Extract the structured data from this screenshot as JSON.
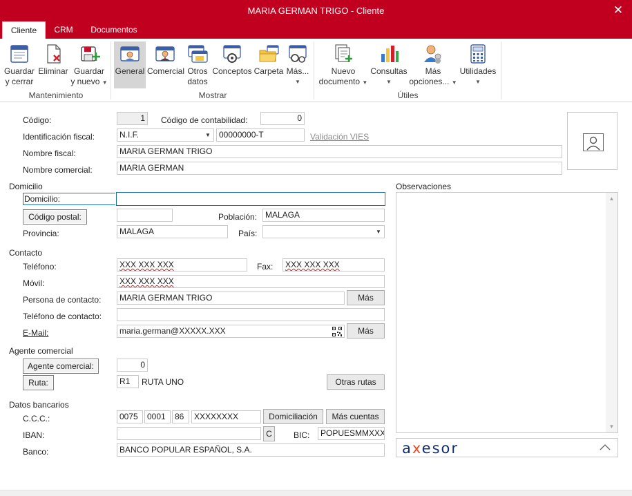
{
  "window": {
    "title": "MARIA GERMAN TRIGO - Cliente"
  },
  "tabs": [
    {
      "label": "Cliente",
      "active": true
    },
    {
      "label": "CRM"
    },
    {
      "label": "Documentos"
    }
  ],
  "ribbon": {
    "groups": {
      "mantenimiento": "Mantenimiento",
      "mostrar": "Mostrar",
      "utiles": "Útiles"
    },
    "buttons": {
      "guardar_cerrar": [
        "Guardar",
        "y cerrar"
      ],
      "eliminar": "Eliminar",
      "guardar_nuevo": [
        "Guardar",
        "y nuevo"
      ],
      "general": "General",
      "comercial": "Comercial",
      "otros_datos": [
        "Otros",
        "datos"
      ],
      "conceptos": "Conceptos",
      "carpeta": "Carpeta",
      "mas": "Más...",
      "nuevo_documento": [
        "Nuevo",
        "documento"
      ],
      "consultas": "Consultas",
      "mas_opciones": [
        "Más",
        "opciones..."
      ],
      "utilidades": "Utilidades"
    }
  },
  "form": {
    "codigo": {
      "label": "Código:",
      "value": "1"
    },
    "codigo_contabilidad": {
      "label": "Código de contabilidad:",
      "value": "0"
    },
    "identificacion_fiscal": {
      "label": "Identificación fiscal:",
      "type": "N.I.F.",
      "value": "00000000-T",
      "link": "Validación VIES"
    },
    "nombre_fiscal": {
      "label": "Nombre fiscal:",
      "value": "MARIA GERMAN TRIGO"
    },
    "nombre_comercial": {
      "label": "Nombre comercial:",
      "value": "MARIA GERMAN"
    },
    "domicilio_section": "Domicilio",
    "domicilio": {
      "label": "Domicilio:",
      "value": ""
    },
    "codigo_postal": {
      "button": "Código postal:",
      "value": ""
    },
    "poblacion": {
      "label": "Población:",
      "value": "MALAGA"
    },
    "provincia": {
      "label": "Provincia:",
      "value": "MALAGA"
    },
    "pais": {
      "label": "País:",
      "value": ""
    },
    "contacto_section": "Contacto",
    "telefono": {
      "label": "Teléfono:",
      "value": "XXX XXX XXX"
    },
    "fax": {
      "label": "Fax:",
      "value": "XXX XXX XXX"
    },
    "movil": {
      "label": "Móvil:",
      "value": "XXX XXX XXX"
    },
    "persona_contacto": {
      "label": "Persona de contacto:",
      "value": "MARIA GERMAN TRIGO",
      "button": "Más"
    },
    "telefono_contacto": {
      "label": "Teléfono de contacto:",
      "value": ""
    },
    "email": {
      "label": "E-Mail:",
      "value": "maria.german@XXXXX.XXX",
      "button": "Más"
    },
    "agente_section": "Agente comercial",
    "agente_comercial": {
      "button": "Agente comercial:",
      "value": "0"
    },
    "ruta": {
      "button": "Ruta:",
      "code": "R1",
      "name": "RUTA UNO",
      "otras_rutas": "Otras rutas"
    },
    "bancarios_section": "Datos bancarios",
    "ccc": {
      "label": "C.C.C.:",
      "entidad": "0075",
      "oficina": "0001",
      "dc": "86",
      "cuenta": "XXXXXXXX",
      "domiciliacion": "Domiciliación",
      "mas_cuentas": "Más cuentas"
    },
    "iban": {
      "label": "IBAN:",
      "value": "",
      "c_button": "C"
    },
    "bic": {
      "label": "BIC:",
      "value": "POPUESMMXXX"
    },
    "banco": {
      "label": "Banco:",
      "value": "BANCO POPULAR ESPAÑOL, S.A."
    }
  },
  "observaciones": {
    "label": "Observaciones",
    "value": ""
  },
  "axesor": {
    "logo_a": "a",
    "logo_x": "x",
    "logo_rest": "esor"
  }
}
